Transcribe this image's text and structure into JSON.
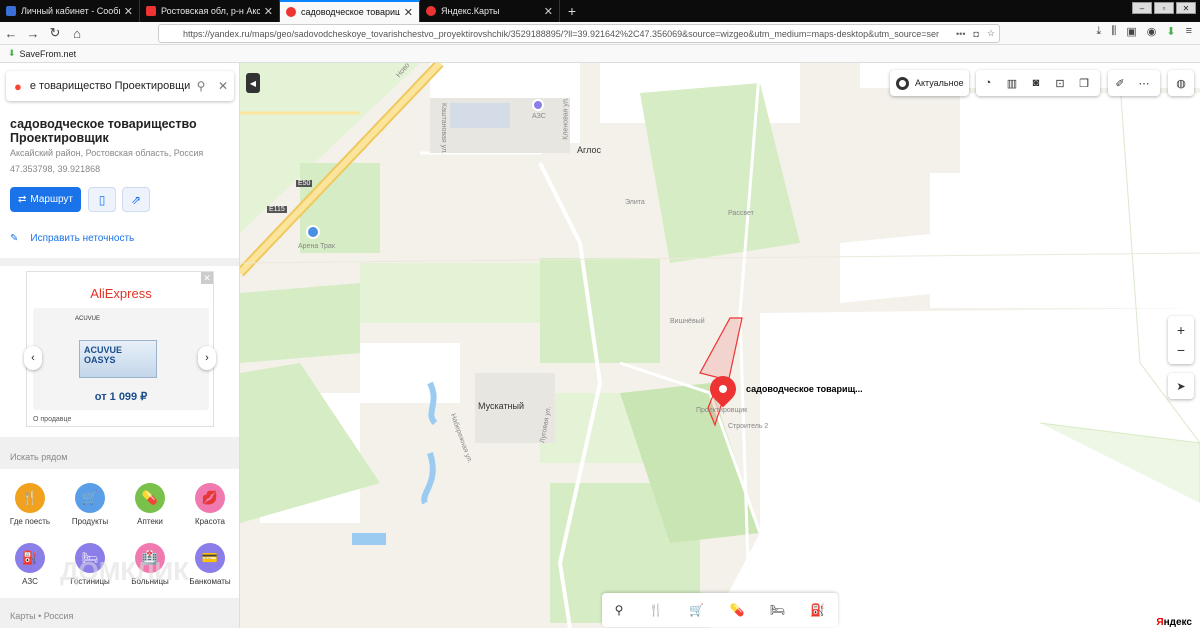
{
  "browser": {
    "tabs": [
      {
        "label": "Личный кабинет - Сообщени",
        "color": "#3b6fd8",
        "active": false
      },
      {
        "label": "Ростовская обл, р-н Аксайск",
        "color": "#e33",
        "active": false
      },
      {
        "label": "садоводческое товарищество",
        "color": "#e33",
        "active": true
      },
      {
        "label": "Яндекс.Карты",
        "color": "#e33",
        "active": false
      }
    ],
    "new_tab": "+",
    "url": "https://yandex.ru/maps/geo/sadovodcheskoye_tovarishchestvo_proyektirovshchik/3529188895/?ll=39.921642%2C47.356069&source=wizgeo&utm_medium=maps-desktop&utm_source=ser",
    "url_more": "•••",
    "bookmark": "SaveFrom.net"
  },
  "sidebar": {
    "search_query": "е товарищество Проектировщик",
    "title": "садоводческое товарищество Проектировщик",
    "address": "Аксайский район, Ростовская область, Россия",
    "coords": "47.353798, 39.921868",
    "route_label": "Маршрут",
    "fix_label": "Исправить неточность",
    "ad": {
      "brand": "AliExpress",
      "product_small": "ACUVUE",
      "product": "ACUVUE OASYS",
      "price": "от 1 099 ₽",
      "footer": "О продавце",
      "close": "✕"
    },
    "nearby_title": "Искать рядом",
    "categories": [
      {
        "label": "Где поесть",
        "color": "#f0a21e",
        "icon": "🍴"
      },
      {
        "label": "Продукты",
        "color": "#5b9ee8",
        "icon": "🛒"
      },
      {
        "label": "Аптеки",
        "color": "#79c14b",
        "icon": "💊"
      },
      {
        "label": "Красота",
        "color": "#f07ab0",
        "icon": "💋"
      },
      {
        "label": "АЗС",
        "color": "#8b7ee8",
        "icon": "⛽"
      },
      {
        "label": "Гостиницы",
        "color": "#8b7ee8",
        "icon": "🛏"
      },
      {
        "label": "Больницы",
        "color": "#f07ab0",
        "icon": "🏥"
      },
      {
        "label": "Банкоматы",
        "color": "#8b7ee8",
        "icon": "💳"
      }
    ],
    "watermark": "ДОМКЛИК",
    "breadcrumbs": "Карты • Россия"
  },
  "map": {
    "labels": {
      "novo": "Ново",
      "kashtanovaya": "Каштановая ул.",
      "azs": "АЗС",
      "klenovaya": "Кленовая ул.",
      "aglos": "Аглос",
      "elita": "Элита",
      "rassvet": "Рассвет",
      "e50": "E50",
      "e115": "E115",
      "arena": "Арена Трак",
      "vishnevy": "Вишнёвый",
      "muskatny": "Мускатный",
      "lugovaya": "Луговая ул.",
      "naberezhnaya": "Набережная ул.",
      "proekt": "Проектировщик",
      "stroitel": "Строитель 2",
      "pin": "садоводческое товарищ..."
    },
    "actual_label": "Актуальное",
    "zoom_in": "+",
    "zoom_out": "−",
    "logo_red": "Я",
    "logo_rest": "ндекс"
  }
}
